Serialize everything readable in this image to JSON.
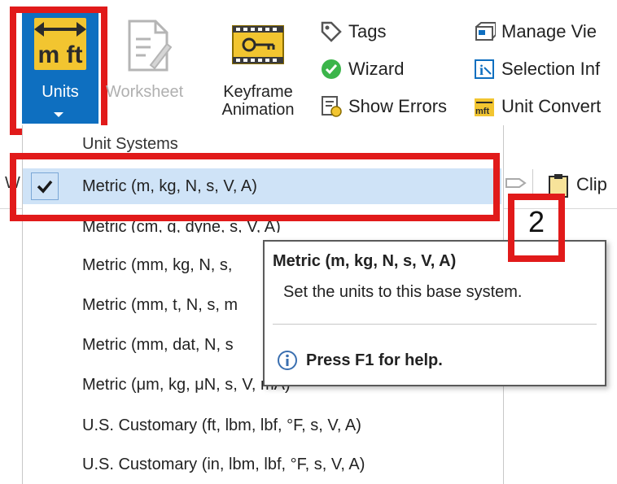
{
  "ribbon": {
    "units_label": "Units",
    "worksheet_label": "Worksheet",
    "keyframe_label_1": "Keyframe",
    "keyframe_label_2": "Animation",
    "tags_label": "Tags",
    "wizard_label": "Wizard",
    "show_errors_label": "Show Errors",
    "manage_views_label": "Manage Vie",
    "selection_info_label": "Selection Inf",
    "unit_converter_label": "Unit Convert"
  },
  "toolbar_partial": {
    "clip_label": "Clip",
    "left_fragment": "W"
  },
  "dropdown": {
    "header": "Unit Systems",
    "items": [
      "Metric (m, kg, N, s, V, A)",
      "Metric (cm, g, dyne, s, V, A)",
      "Metric (mm, kg, N, s, ",
      "Metric (mm, t, N, s, m",
      "Metric (mm, dat, N, s",
      "Metric (μm, kg, μN, s, V, mA)",
      "U.S. Customary (ft, lbm, lbf, °F, s, V, A)",
      "U.S. Customary (in, lbm, lbf, °F, s, V, A)"
    ],
    "selected_index": 0
  },
  "tooltip": {
    "title": "Metric (m, kg, N, s, V, A)",
    "description": "Set the units to this base system.",
    "help": "Press F1 for help."
  },
  "annotation": {
    "callout_number": "2"
  },
  "colors": {
    "accent": "#0e6fc0",
    "highlight": "#e11a1a",
    "selection": "#cfe3f7",
    "icon_yellow": "#f2c530"
  }
}
